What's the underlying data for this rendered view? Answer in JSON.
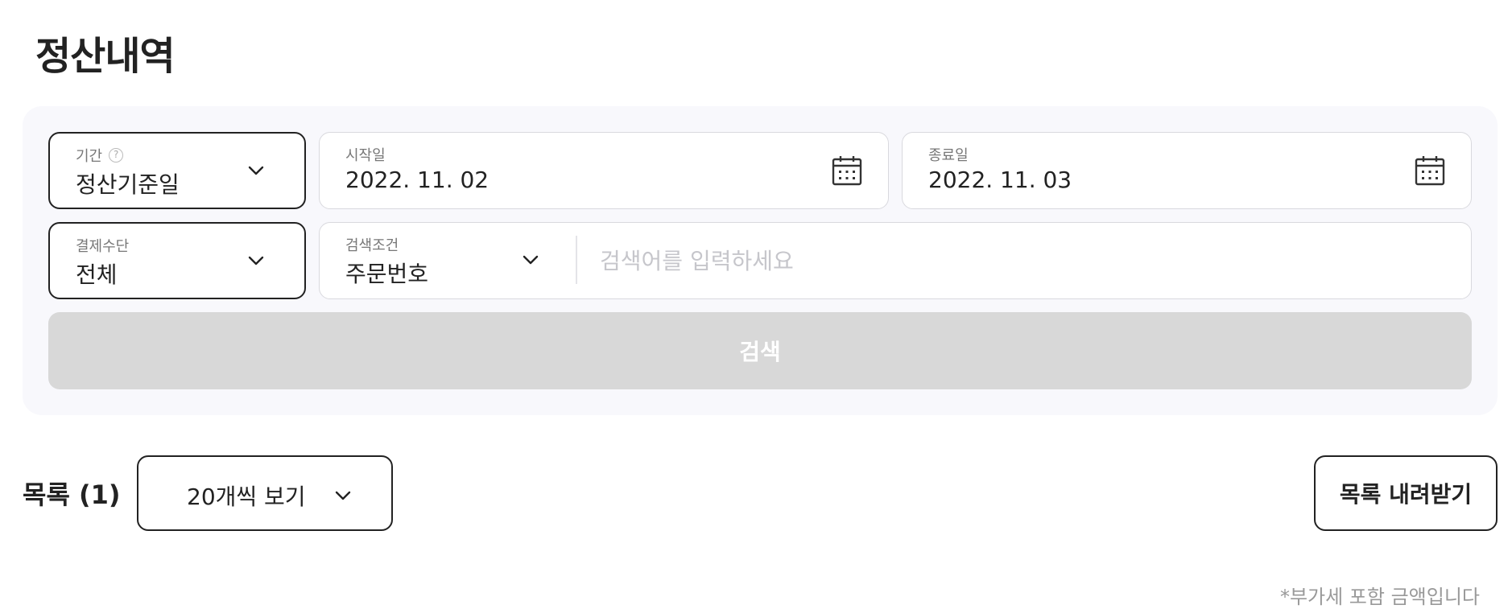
{
  "page": {
    "title": "정산내역"
  },
  "filters": {
    "period": {
      "label": "기간",
      "value": "정산기준일"
    },
    "start_date": {
      "label": "시작일",
      "value": "2022. 11. 02"
    },
    "end_date": {
      "label": "종료일",
      "value": "2022. 11. 03"
    },
    "payment_method": {
      "label": "결제수단",
      "value": "전체"
    },
    "search_condition": {
      "label": "검색조건",
      "value": "주문번호"
    },
    "search": {
      "placeholder": "검색어를 입력하세요",
      "value": ""
    },
    "search_button": "검색"
  },
  "list": {
    "title": "목록 (1)",
    "page_size": "20개씩 보기",
    "download_button": "목록 내려받기",
    "footnote": "*부가세 포함 금액입니다"
  },
  "icons": {
    "help": "help-circle-icon",
    "chevron": "chevron-down-icon",
    "calendar": "calendar-icon"
  }
}
